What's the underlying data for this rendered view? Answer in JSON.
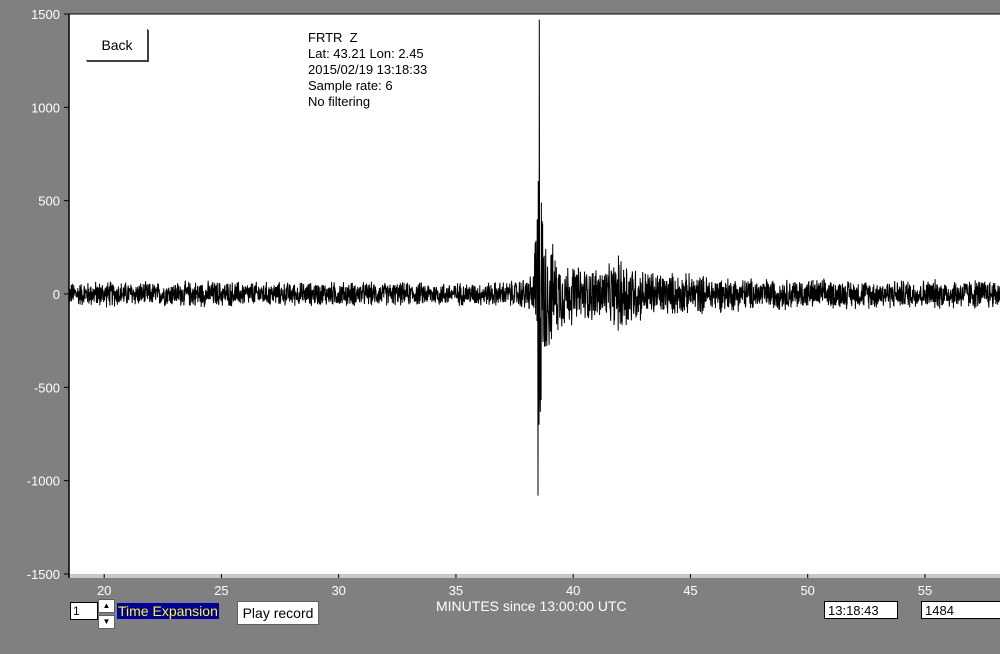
{
  "controls": {
    "back_label": "Back",
    "expansion_value": "1",
    "time_expansion_label": "Time Expansion",
    "play_label": "Play record",
    "current_time": "13:18:43",
    "current_value": "1484",
    "up_arrow": "▲",
    "down_arrow": "▼"
  },
  "info": {
    "station": "FRTR  Z",
    "location": "Lat: 43.21 Lon: 2.45",
    "datetime": "2015/02/19 13:18:33",
    "sample_rate": "Sample rate: 6",
    "filter": "No filtering"
  },
  "colors": {
    "background": "#808080",
    "plot_bg": "#ffffff",
    "trace": "#000000",
    "label_text": "#ffffff",
    "expansion_text": "#ffff00",
    "expansion_bg": "#0000a0"
  },
  "chart_data": {
    "type": "line",
    "title": "",
    "xlabel": "MINUTES since 13:00:00 UTC",
    "ylabel": "",
    "xlim": [
      18.5,
      58.2
    ],
    "ylim": [
      -1500,
      1500
    ],
    "xticks": [
      20,
      25,
      30,
      35,
      40,
      45,
      50,
      55
    ],
    "yticks": [
      1500,
      1000,
      500,
      0,
      -500,
      -1000,
      -1500
    ],
    "grid": false,
    "series": [
      {
        "x": [
          18.5,
          20,
          22,
          24,
          26,
          28,
          30,
          32,
          34,
          36,
          37.5,
          38.3,
          38.5,
          38.55,
          38.6,
          38.7,
          38.8,
          39.0,
          39.3,
          39.6,
          40.0,
          40.5,
          41.0,
          41.5,
          42.0,
          42.3,
          42.6,
          43.0,
          44.0,
          45.0,
          46.0,
          47.0,
          48.0,
          50.0,
          52.0,
          54.0,
          56.0,
          58.2
        ],
        "envelope": [
          70,
          80,
          70,
          80,
          75,
          70,
          75,
          70,
          70,
          70,
          80,
          120,
          800,
          1470,
          900,
          500,
          400,
          330,
          240,
          200,
          180,
          160,
          170,
          165,
          240,
          230,
          180,
          150,
          130,
          120,
          110,
          100,
          95,
          90,
          85,
          85,
          90,
          90
        ],
        "peak_min_x": 38.5,
        "peak_min_value": -1080
      }
    ]
  }
}
